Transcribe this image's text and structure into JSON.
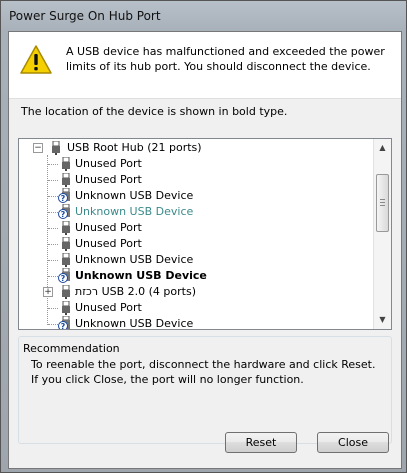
{
  "window": {
    "title": "Power Surge On Hub Port"
  },
  "message": "A USB device has malfunctioned and exceeded the power limits of its hub port. You should disconnect the device.",
  "location_text": "The location of the device is shown in bold type.",
  "tree": {
    "root": "USB Root Hub (21 ports)",
    "items": [
      {
        "label": "Unused Port",
        "icon": "usb-plug-icon"
      },
      {
        "label": "Unused Port",
        "icon": "usb-plug-icon"
      },
      {
        "label": "Unknown USB Device",
        "icon": "unknown-device-icon"
      },
      {
        "label": "Unknown USB Device",
        "icon": "unknown-device-icon",
        "selected": true
      },
      {
        "label": "Unused Port",
        "icon": "usb-plug-icon"
      },
      {
        "label": "Unused Port",
        "icon": "usb-plug-icon"
      },
      {
        "label": "Unknown USB Device",
        "icon": "unknown-device-icon"
      },
      {
        "label": "Unknown USB Device",
        "icon": "unknown-device-icon",
        "bold": true
      },
      {
        "label": "רכזת USB 2.0 (4 ports)",
        "icon": "usb-plug-icon",
        "expandable": true
      },
      {
        "label": "Unused Port",
        "icon": "usb-plug-icon"
      },
      {
        "label": "Unknown USB Device",
        "icon": "unknown-device-icon"
      }
    ]
  },
  "recommendation": {
    "title": "Recommendation",
    "text": "To reenable the port, disconnect the hardware and click Reset. If you click Close, the port will no longer function."
  },
  "buttons": {
    "reset": "Reset",
    "close": "Close"
  },
  "colors": {
    "selected_text": "#3a8a8a",
    "warning_yellow": "#f5d000"
  }
}
